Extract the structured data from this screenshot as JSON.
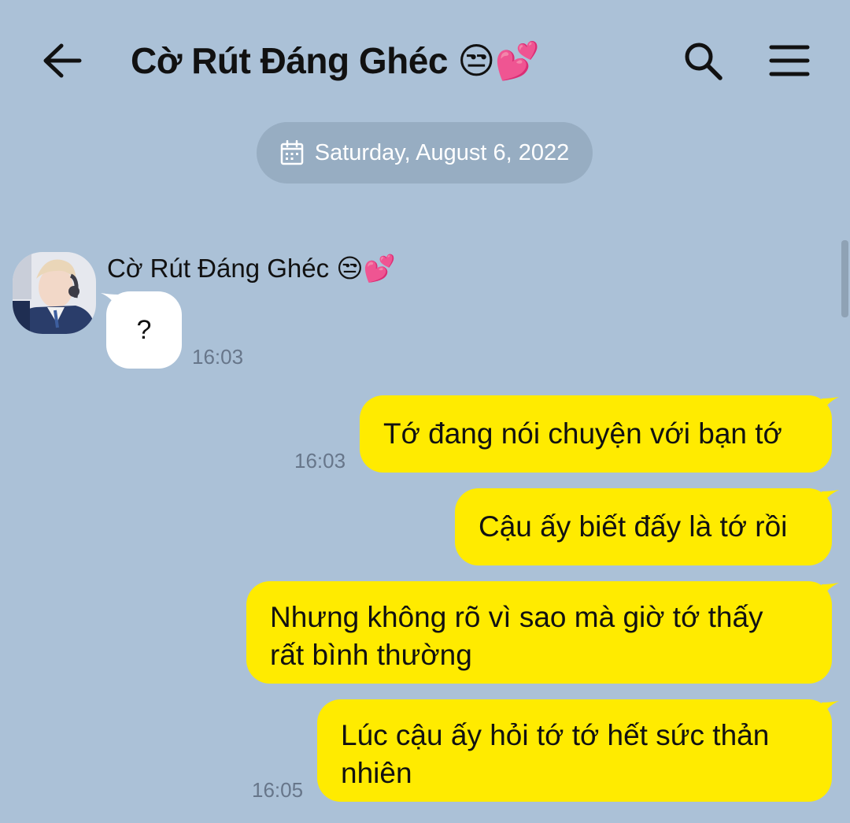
{
  "header": {
    "title": "Cờ Rút Đáng Ghéc 😒💕",
    "back_icon": "arrow-left-icon",
    "search_icon": "search-icon",
    "menu_icon": "hamburger-menu-icon"
  },
  "date_divider": {
    "icon": "calendar-icon",
    "label": "Saturday, August 6, 2022"
  },
  "messages": [
    {
      "direction": "incoming",
      "sender": "Cờ Rút Đáng Ghéc 😒💕",
      "text": "?",
      "time": "16:03"
    },
    {
      "direction": "outgoing",
      "text": "Tớ đang nói chuyện với bạn tớ",
      "time": "16:03"
    },
    {
      "direction": "outgoing",
      "text": "Cậu ấy biết đấy là tớ rồi",
      "time": ""
    },
    {
      "direction": "outgoing",
      "text_lines": [
        "Nhưng không rõ vì sao mà giờ tớ thấy",
        "rất bình thường"
      ],
      "time": ""
    },
    {
      "direction": "outgoing",
      "text_lines": [
        "Lúc cậu ấy hỏi tớ tớ hết sức thản",
        "nhiên"
      ],
      "time": "16:05"
    }
  ],
  "colors": {
    "background": "#abc1d7",
    "outgoing_bubble": "#ffeb00",
    "incoming_bubble": "#ffffff",
    "date_pill": "#97adc2",
    "timestamp": "#67768a"
  }
}
